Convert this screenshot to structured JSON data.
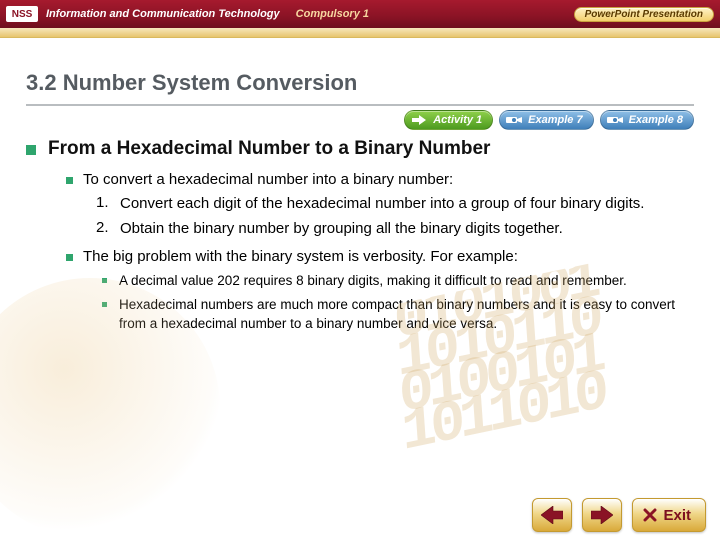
{
  "topbar": {
    "brand_logo": "NSS",
    "brand_text": "Information and Communication Technology",
    "brand_sub": "Compulsory 1",
    "ppt_button": "PowerPoint Presentation"
  },
  "section_title": "3.2  Number System Conversion",
  "buttons": {
    "activity": "Activity 1",
    "example7": "Example 7",
    "example8": "Example 8"
  },
  "subheading": "From a Hexadecimal Number to a Binary Number",
  "block1": {
    "intro": "To convert a hexadecimal number into a binary number:",
    "steps": {
      "n1": "1.",
      "t1": "Convert each digit of the hexadecimal number into a group of four binary digits.",
      "n2": "2.",
      "t2": "Obtain the binary number by grouping all the binary digits together."
    }
  },
  "block2": {
    "intro": "The big problem with the binary system is verbosity. For example:",
    "pts": {
      "p1": "A decimal value 202 requires 8 binary digits, making it difficult to read and remember.",
      "p2": "Hexadecimal numbers are much more compact than binary numbers and it is easy to convert from a hexadecimal number to a binary number and vice versa."
    }
  },
  "footer": {
    "exit": "Exit"
  },
  "deco_digits": "0101001\n1010110\n0100101\n1011010"
}
